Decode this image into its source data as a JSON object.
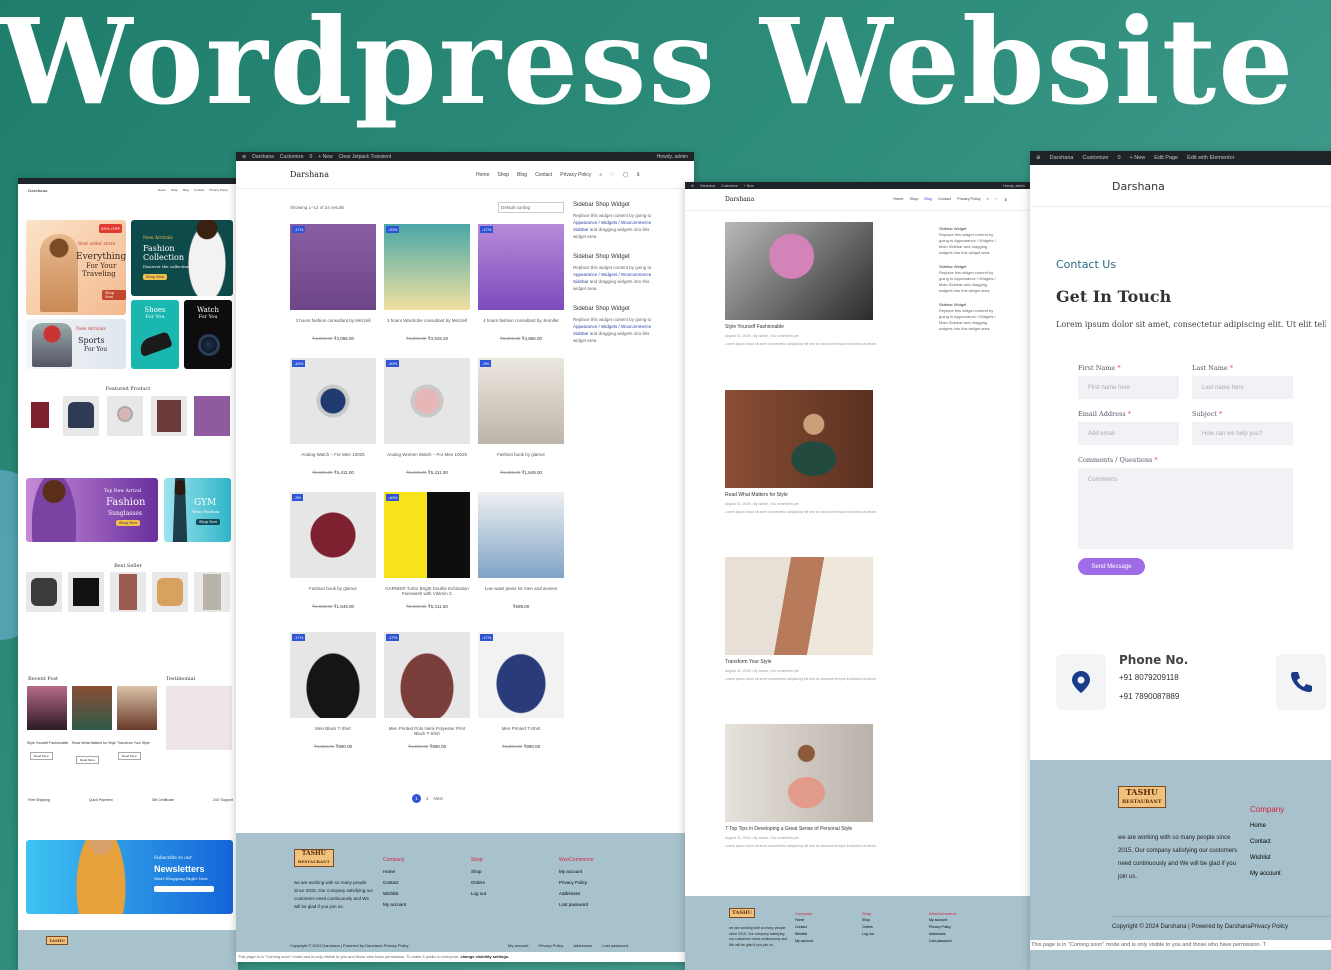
{
  "hero": {
    "title": "Wordpress Website D"
  },
  "colors": {
    "accent_purple": "#a06be6",
    "footer_bg": "#a7c2cc",
    "footer_heading": "#d6233f",
    "admin_bar": "#1d2327",
    "sale_badge": "#2f55d4",
    "link_blue": "#2d3fa0"
  },
  "site": {
    "name": "Darshana"
  },
  "shot1": {
    "hero_left": {
      "badge": "50% OFF",
      "tag": "Best seller store",
      "line1": "Everything",
      "line2": "For Your",
      "line3": "Traveling"
    },
    "hero_right": {
      "tag": "New Arrivals",
      "line1": "Fashion",
      "line2": "Collection",
      "line3": "Discover the collection",
      "btn": "Shop Now"
    },
    "tile_sports": {
      "tag": "New Arrivals",
      "line1": "Sports",
      "line2": "For You"
    },
    "tile_shoes": {
      "line1": "Shoes",
      "line2": "For You"
    },
    "tile_watch": {
      "line1": "Watch",
      "line2": "For You"
    },
    "featured_title": "Featured Product",
    "banner_sun": {
      "tag": "Top New Arrival",
      "line1": "Fashion",
      "line2": "Sunglasses",
      "btn": "Shop Now"
    },
    "banner_gym": {
      "line1": "GYM",
      "line2": "Wear Fashion",
      "btn": "Shop Now"
    },
    "bestseller_title": "Best Seller",
    "recent_post_title": "Recent Post",
    "testimonial_title": "Testimonial",
    "posts": [
      "Style Yourself Fashionable",
      "Read What Matters for Style",
      "Transform Your Style"
    ],
    "read_more": "Read More",
    "features": [
      "Free Shipping",
      "Quick Payment",
      "Gift Certificate",
      "24/7 Support"
    ],
    "newsletter": {
      "tag": "Subscribe to our",
      "title": "Newsletters",
      "sub": "Start Shopping Right Now"
    }
  },
  "shot2": {
    "admin": [
      "Darshana",
      "Customize",
      "0",
      "+ New",
      "Clear Jetpack Transient"
    ],
    "admin_right": "Howdy, admin",
    "menu": [
      "Home",
      "Shop",
      "Blog",
      "Contact",
      "Privacy Policy"
    ],
    "results": "Showing 1–12 of 24 results",
    "sort": "Default sorting",
    "products": [
      {
        "badge": "-17%",
        "title": "3 hours fashion consultant by Mezzell",
        "old": "₹4,899.00",
        "price": "₹4,056.00"
      },
      {
        "badge": "-20%",
        "title": "3 hours Wardrobe consultant by Mezzell",
        "old": "₹4,899.00",
        "price": "₹3,919.20"
      },
      {
        "badge": "-17%",
        "title": "4 hours fashion consultant by Jennifer",
        "old": "₹5,899.00",
        "price": "₹4,856.00"
      },
      {
        "badge": "-40%",
        "title": "Analog Watch – For Men 10025",
        "old": "₹9,699.00",
        "price": "₹5,411.00"
      },
      {
        "badge": "-40%",
        "title": "Analog Women Watch – For Men 10025",
        "old": "₹9,699.00",
        "price": "₹5,411.00"
      },
      {
        "badge": "-3%",
        "title": "Fashion book by glamor",
        "old": "₹1,699.00",
        "price": "₹1,649.00"
      },
      {
        "badge": "-3%",
        "title": "Fashion book by glamor",
        "old": "₹1,699.00",
        "price": "₹1,649.00"
      },
      {
        "badge": "-40%",
        "title": "GARNIER Turbo Bright Double Exfoliation Facewash with Vitamin C",
        "old": "₹9,699.00",
        "price": "₹5,411.00"
      },
      {
        "badge": "",
        "title": "Low waist jeans for men and women",
        "old": "",
        "price": "₹699.00"
      },
      {
        "badge": "-17%",
        "title": "Men Black T-Shirt",
        "old": "₹1,299.00",
        "price": "₹990.00"
      },
      {
        "badge": "-17%",
        "title": "Men Printed Polo Neck Polyester Print Black T-Shirt",
        "old": "₹1,299.00",
        "price": "₹990.00"
      },
      {
        "badge": "-17%",
        "title": "Men Printed T-Shirt",
        "old": "₹1,299.00",
        "price": "₹990.00"
      }
    ],
    "sidebar_title": "Sidebar Shop Widget",
    "sidebar_text_1": "Replace this widget content by going to",
    "sidebar_link": "Appearance / Widgets / Woocommerce Sidebar",
    "sidebar_text_2": "and dragging widgets into this widget area.",
    "pages": [
      "1",
      "2",
      "Next"
    ],
    "footer": {
      "desc": "we are working with so many people since 2015, Our company satisfying our customers need continuously and We will be glad if you join us.",
      "col1": {
        "title": "Company",
        "items": [
          "Home",
          "Contact",
          "Wishlist",
          "My account"
        ]
      },
      "col2": {
        "title": "Shop",
        "items": [
          "Shop",
          "Orders",
          "Log out"
        ]
      },
      "col3": {
        "title": "WooCommerce",
        "items": [
          "My account",
          "Privacy Policy",
          "Addresses",
          "Lost password"
        ]
      },
      "copyright": "Copyright © 2024 Darshana | Powered by Darshana Privacy Policy",
      "bottom_links": [
        "My account",
        "Privacy Policy",
        "Addresses",
        "Lost password"
      ],
      "coming_soon": "This page is in \"Coming soon\" mode and is only visible to you and those who have permission. To make it public to everyone,",
      "change_link": "change visibility settings."
    }
  },
  "shot3": {
    "posts": [
      {
        "title": "Style Yourself Fashionable",
        "meta": "August 31, 2024 • By admin • No comments yet"
      },
      {
        "title": "Read What Matters for Style",
        "meta": "August 31, 2024 • By admin • No comments yet"
      },
      {
        "title": "Transform Your Style",
        "meta": "August 31, 2024 • By admin • No comments yet"
      },
      {
        "title": "7 Top Tips in Developing a Great Sense of Personal Style",
        "meta": "August 31, 2024 • By admin • No comments yet"
      }
    ],
    "excerpt": "Lorem ipsum dolor sit amet consectetur adipiscing elit sed do eiusmod tempor incididunt ut labore.",
    "sidebar_title": "Sidebar Widget",
    "sidebar_text": "Replace this widget content by going to Appearance / Widgets / Main Sidebar and dragging widgets into this widget area."
  },
  "shot4": {
    "admin": [
      "Darshana",
      "Customize",
      "0",
      "+ New",
      "Edit Page",
      "Edit with Elementor"
    ],
    "logo": "Darshana",
    "eyebrow": "Contact Us",
    "heading": "Get In Touch",
    "intro": "Lorem ipsum dolor sit amet, consectetur adipiscing elit. Ut elit tellus",
    "first_label": "First Name",
    "first_ph": "First name here",
    "last_label": "Last Name",
    "last_ph": "Last name here",
    "email_label": "Email Address",
    "email_ph": "Add email",
    "subject_label": "Subject",
    "subject_ph": "How can we help you?",
    "comments_label": "Comments / Questions",
    "comments_ph": "Comments",
    "send": "Send Message",
    "phone_title": "Phone No.",
    "phone1": "+91 8079209118",
    "phone2": "+91 7890087889",
    "footer_desc": "we are working with so many people since 2015, Our company satisfying our customers need continuously and We will be glad if you join us.",
    "footer_col_title": "Company",
    "footer_items": [
      "Home",
      "Contact",
      "Wishlist",
      "My account"
    ],
    "copyright": "Copyright © 2024 Darshana | Powered by DarshanaPrivacy Policy",
    "coming_soon": "This page is in \"Coming soon\" mode and is only visible to you and those who have permission. T"
  },
  "brand_logo": {
    "top": "TASHU",
    "bottom": "RESTAURANT"
  }
}
